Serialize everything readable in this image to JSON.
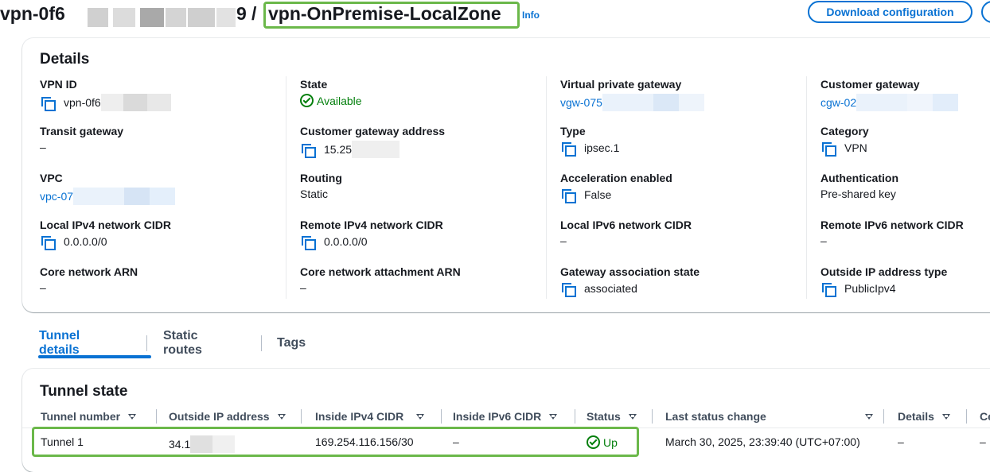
{
  "header": {
    "title_prefix": "vpn-0f6",
    "title_suffix": "9",
    "title_separator": "/",
    "vpn_name": "vpn-OnPremise-LocalZone",
    "info_label": "Info",
    "download_button": "Download configuration",
    "redaction_colors": [
      "#d0d0d0",
      "#b0b0b0",
      "#a5a5a5",
      "#d8d8d8",
      "#cfcfcf"
    ]
  },
  "details": {
    "title": "Details",
    "columns": [
      [
        {
          "label": "VPN ID",
          "value": "vpn-0f6",
          "copy": true,
          "kind": "text"
        },
        {
          "label": "Transit gateway",
          "value": "–",
          "copy": false,
          "kind": "text"
        },
        {
          "label": "VPC",
          "value": "vpc-07",
          "copy": false,
          "kind": "link"
        },
        {
          "label": "Local IPv4 network CIDR",
          "value": "0.0.0.0/0",
          "copy": true,
          "kind": "text"
        },
        {
          "label": "Core network ARN",
          "value": "–",
          "copy": false,
          "kind": "text"
        }
      ],
      [
        {
          "label": "State",
          "value": "Available",
          "copy": false,
          "kind": "status"
        },
        {
          "label": "Customer gateway address",
          "value": "15.25",
          "copy": true,
          "kind": "text"
        },
        {
          "label": "Routing",
          "value": "Static",
          "copy": false,
          "kind": "text"
        },
        {
          "label": "Remote IPv4 network CIDR",
          "value": "0.0.0.0/0",
          "copy": true,
          "kind": "text"
        },
        {
          "label": "Core network attachment ARN",
          "value": "–",
          "copy": false,
          "kind": "text"
        }
      ],
      [
        {
          "label": "Virtual private gateway",
          "value": "vgw-075",
          "copy": false,
          "kind": "link"
        },
        {
          "label": "Type",
          "value": "ipsec.1",
          "copy": true,
          "kind": "text"
        },
        {
          "label": "Acceleration enabled",
          "value": "False",
          "copy": true,
          "kind": "text"
        },
        {
          "label": "Local IPv6 network CIDR",
          "value": "–",
          "copy": false,
          "kind": "text"
        },
        {
          "label": "Gateway association state",
          "value": "associated",
          "copy": true,
          "kind": "text"
        }
      ],
      [
        {
          "label": "Customer gateway",
          "value": "cgw-02",
          "copy": false,
          "kind": "link"
        },
        {
          "label": "Category",
          "value": "VPN",
          "copy": true,
          "kind": "text"
        },
        {
          "label": "Authentication",
          "value": "Pre-shared key",
          "copy": false,
          "kind": "text"
        },
        {
          "label": "Remote IPv6 network CIDR",
          "value": "–",
          "copy": false,
          "kind": "text"
        },
        {
          "label": "Outside IP address type",
          "value": "PublicIpv4",
          "copy": true,
          "kind": "text"
        }
      ]
    ]
  },
  "tabs": [
    {
      "label": "Tunnel details",
      "active": true
    },
    {
      "label": "Static routes",
      "active": false
    },
    {
      "label": "Tags",
      "active": false
    }
  ],
  "tunnel_state": {
    "title": "Tunnel state",
    "headers": [
      "Tunnel number",
      "Outside IP address",
      "Inside IPv4 CIDR",
      "Inside IPv6 CIDR",
      "Status",
      "Last status change",
      "Details",
      "Ce"
    ],
    "rows": [
      {
        "tunnel_number": "Tunnel 1",
        "outside_ip": "34.1",
        "inside_ipv4": "169.254.116.156/30",
        "inside_ipv6": "–",
        "status": "Up",
        "last_change": "March 30, 2025, 23:39:40 (UTC+07:00)",
        "details": "–",
        "certificate": "–"
      }
    ]
  },
  "colors": {
    "link": "#0972d3",
    "success": "#037f0c",
    "highlight": "#6bb84a"
  }
}
